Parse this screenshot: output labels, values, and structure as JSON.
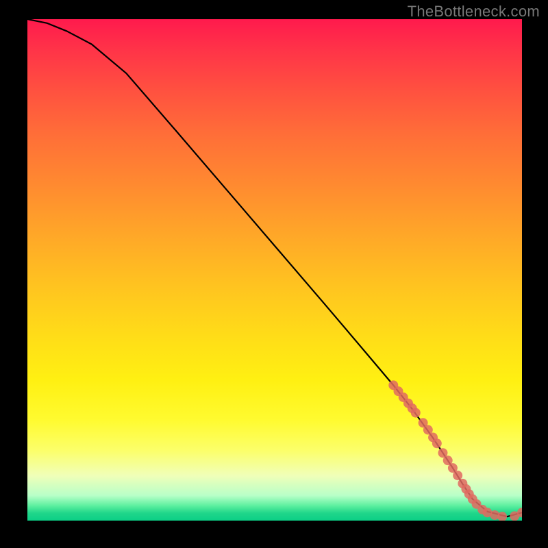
{
  "watermark": "TheBottleneck.com",
  "chart_data": {
    "type": "line",
    "title": "",
    "xlabel": "",
    "ylabel": "",
    "xlim": [
      0,
      100
    ],
    "ylim": [
      0,
      100
    ],
    "grid": false,
    "legend": false,
    "background": "heatmap-gradient-red-yellow-green",
    "series": [
      {
        "name": "curve",
        "style": "solid-black",
        "x": [
          0,
          4,
          8,
          13,
          20,
          30,
          40,
          50,
          60,
          68,
          74,
          78,
          82,
          86,
          88,
          90,
          93,
          97,
          100
        ],
        "y": [
          100,
          99.2,
          97.6,
          95.0,
          89.2,
          77.8,
          66.3,
          54.8,
          43.3,
          34.0,
          27.0,
          22.0,
          16.5,
          10.5,
          7.3,
          4.3,
          1.8,
          0.8,
          1.6
        ]
      },
      {
        "name": "highlight-points",
        "style": "dots-coral",
        "comment": "Cluster of points near the bottom-right where curve flattens",
        "x": [
          74.0,
          75.0,
          76.0,
          77.0,
          77.8,
          78.5,
          80.0,
          81.0,
          82.0,
          82.8,
          84.0,
          85.0,
          86.0,
          87.0,
          88.0,
          88.7,
          89.3,
          90.0,
          90.8,
          92.0,
          93.0,
          94.5,
          96.0,
          98.5,
          100.0
        ],
        "y": [
          27.0,
          25.8,
          24.6,
          23.4,
          22.4,
          21.5,
          19.5,
          18.1,
          16.6,
          15.4,
          13.5,
          12.0,
          10.5,
          9.0,
          7.4,
          6.3,
          5.3,
          4.3,
          3.3,
          2.2,
          1.6,
          1.1,
          0.8,
          0.9,
          1.6
        ]
      }
    ]
  }
}
